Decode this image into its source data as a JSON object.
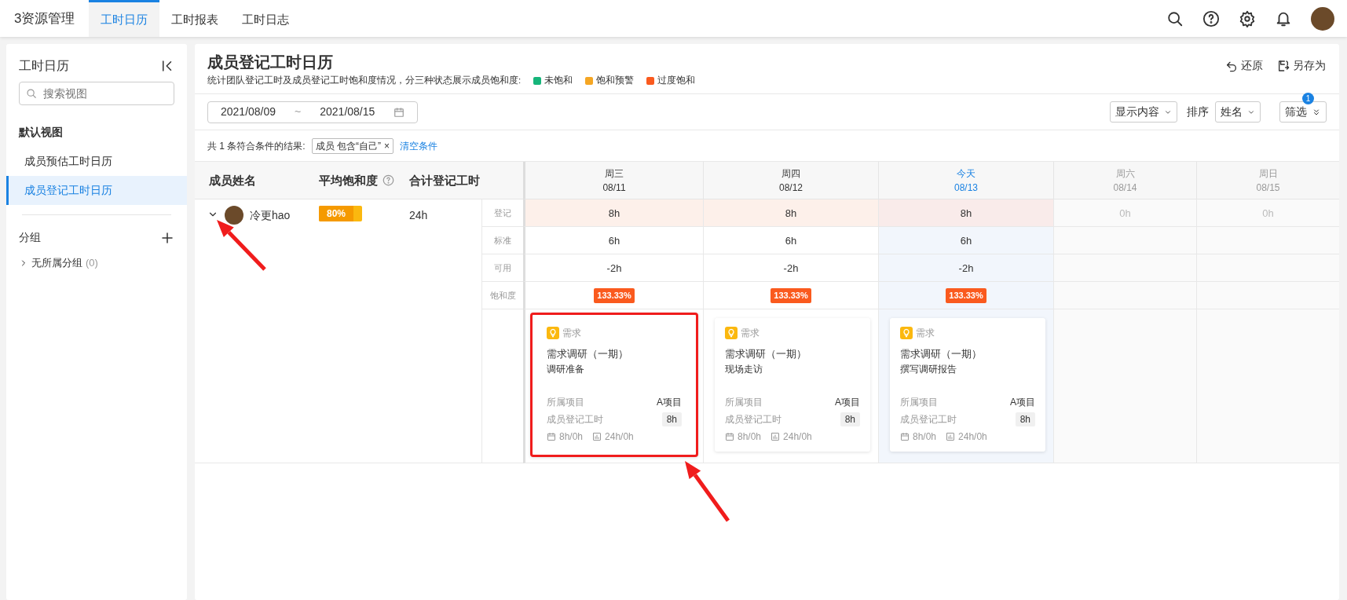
{
  "app": {
    "title": "3资源管理",
    "tabs": [
      {
        "label": "工时日历",
        "selected": true
      },
      {
        "label": "工时报表",
        "selected": false
      },
      {
        "label": "工时日志",
        "selected": false
      }
    ]
  },
  "sidebar": {
    "title": "工时日历",
    "search_placeholder": "搜索视图",
    "section": "默认视图",
    "views": [
      {
        "label": "成员预估工时日历",
        "selected": false
      },
      {
        "label": "成员登记工时日历",
        "selected": true
      }
    ],
    "group_title": "分组",
    "groups": [
      {
        "label": "无所属分组",
        "count": "(0)",
        "expanded": false
      }
    ]
  },
  "page": {
    "title": "成员登记工时日历",
    "description": "统计团队登记工时及成员登记工时饱和度情况，分三种状态展示成员饱和度:",
    "legend": [
      {
        "label": "未饱和",
        "color": "#16b57a"
      },
      {
        "label": "饱和预警",
        "color": "#f5a623"
      },
      {
        "label": "过度饱和",
        "color": "#fa5a1e"
      }
    ],
    "actions": [
      {
        "label": "还原",
        "kind": "undo"
      },
      {
        "label": "另存为",
        "kind": "save-as"
      }
    ]
  },
  "date_range": {
    "start": "2021/08/09",
    "separator": "~",
    "end": "2021/08/15"
  },
  "toolbar": {
    "display": "显示内容",
    "sort_label": "排序",
    "sort": "姓名",
    "filter": "筛选",
    "filter_badge": "1"
  },
  "result": {
    "summary": "共 1 条符合条件的结果:",
    "tag": "成员 包含“自己”",
    "tag_close": "×",
    "clear": "清空条件"
  },
  "table": {
    "columns": [
      "成员姓名",
      "平均饱和度",
      "合计登记工时"
    ],
    "row_labels": [
      "登记",
      "标准",
      "可用",
      "饱和度"
    ],
    "member": {
      "name": "冷更hao",
      "expanded": true,
      "saturation": "80%",
      "level": 0.8,
      "total": "24h"
    },
    "days": [
      {
        "weekday": "周三",
        "date": "08/11",
        "today": false,
        "weekend": false,
        "registered": "8h",
        "standard": "6h",
        "available": "-2h",
        "saturation": "133.33%",
        "card": {
          "type": "需求",
          "title": "需求调研（一期）",
          "subtitle": "调研准备",
          "project_label": "所属项目",
          "project": "A项目",
          "hours_label": "成员登记工时",
          "hours": "8h",
          "day_stat": "8h/0h",
          "total_stat": "24h/0h",
          "highlighted": true
        }
      },
      {
        "weekday": "周四",
        "date": "08/12",
        "today": false,
        "weekend": false,
        "registered": "8h",
        "standard": "6h",
        "available": "-2h",
        "saturation": "133.33%",
        "card": {
          "type": "需求",
          "title": "需求调研（一期）",
          "subtitle": "现场走访",
          "project_label": "所属项目",
          "project": "A项目",
          "hours_label": "成员登记工时",
          "hours": "8h",
          "day_stat": "8h/0h",
          "total_stat": "24h/0h",
          "highlighted": false
        }
      },
      {
        "weekday": "今天",
        "date": "08/13",
        "today": true,
        "weekend": false,
        "registered": "8h",
        "standard": "6h",
        "available": "-2h",
        "saturation": "133.33%",
        "card": {
          "type": "需求",
          "title": "需求调研（一期）",
          "subtitle": "撰写调研报告",
          "project_label": "所属项目",
          "project": "A项目",
          "hours_label": "成员登记工时",
          "hours": "8h",
          "day_stat": "8h/0h",
          "total_stat": "24h/0h",
          "highlighted": false
        }
      },
      {
        "weekday": "周六",
        "date": "08/14",
        "today": false,
        "weekend": true,
        "registered": "0h"
      },
      {
        "weekday": "周日",
        "date": "08/15",
        "today": false,
        "weekend": true,
        "registered": "0h"
      }
    ]
  }
}
